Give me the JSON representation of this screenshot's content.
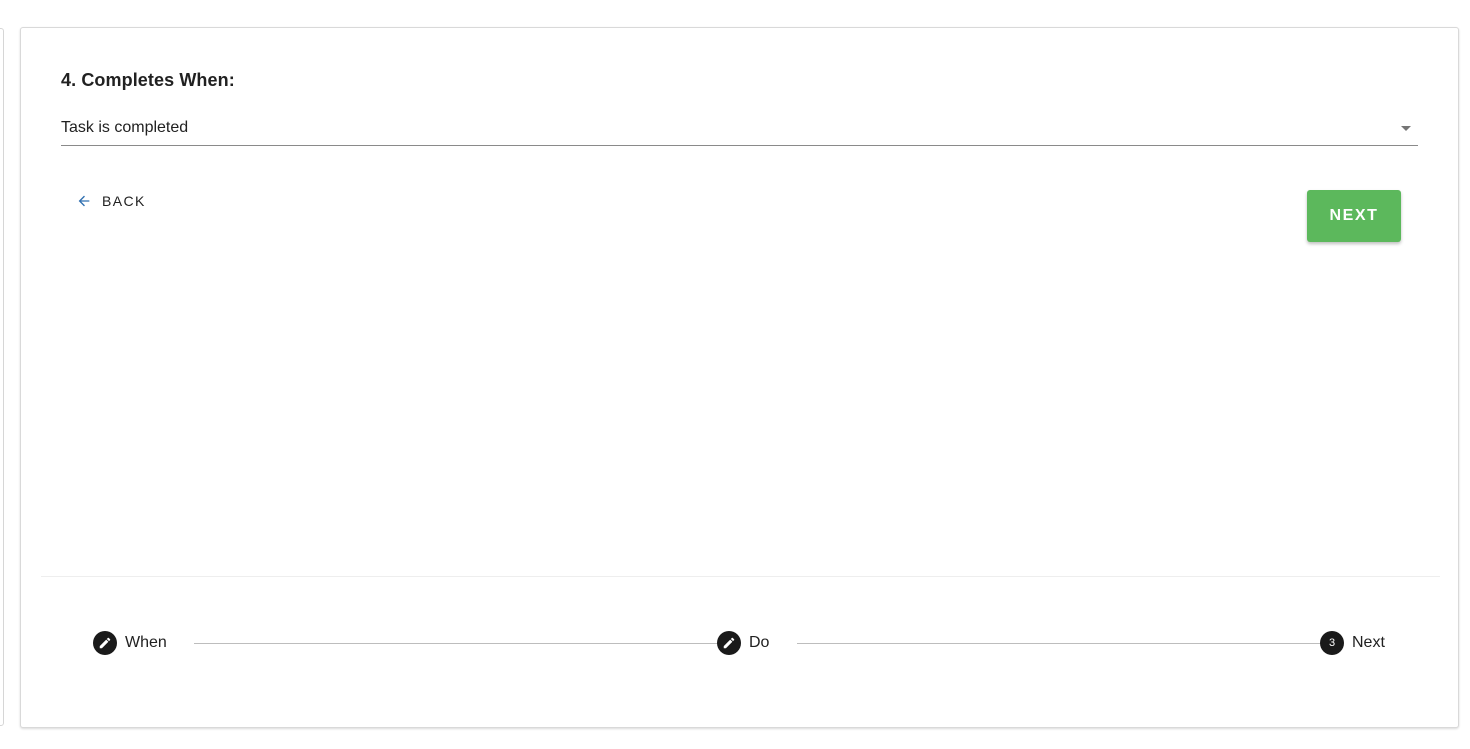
{
  "form": {
    "section_title": "4. Completes When:",
    "completes_when": {
      "value": "Task is completed"
    }
  },
  "actions": {
    "back_label": "BACK",
    "next_label": "NEXT",
    "next_color": "#5cb85c"
  },
  "stepper": {
    "steps": [
      {
        "label": "When",
        "icon": "pencil-icon"
      },
      {
        "label": "Do",
        "icon": "pencil-icon"
      },
      {
        "label": "Next",
        "number": "3"
      }
    ]
  }
}
